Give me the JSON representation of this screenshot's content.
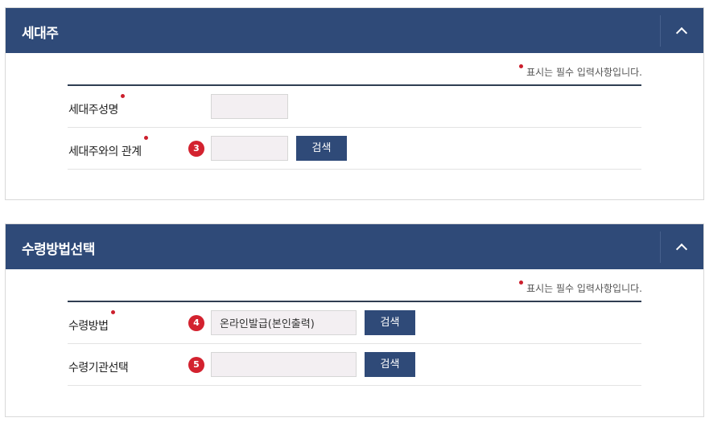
{
  "householder_section": {
    "title": "세대주",
    "required_note": "표시는 필수 입력사항입니다.",
    "rows": [
      {
        "label": "세대주성명",
        "required": true,
        "input_value": ""
      },
      {
        "label": "세대주와의 관계",
        "required": true,
        "step": "3",
        "input_value": "",
        "button_label": "검색"
      }
    ]
  },
  "receipt_section": {
    "title": "수령방법선택",
    "required_note": "표시는 필수 입력사항입니다.",
    "rows": [
      {
        "label": "수령방법",
        "required": true,
        "step": "4",
        "input_value": "온라인발급(본인출력)",
        "button_label": "검색"
      },
      {
        "label": "수령기관선택",
        "required": false,
        "step": "5",
        "input_value": "",
        "button_label": "검색"
      }
    ]
  },
  "colors": {
    "header_bg": "#2f4a78",
    "required_dot": "#cc1f2d",
    "step_badge": "#d3222f",
    "input_bg": "#f3eff2"
  }
}
